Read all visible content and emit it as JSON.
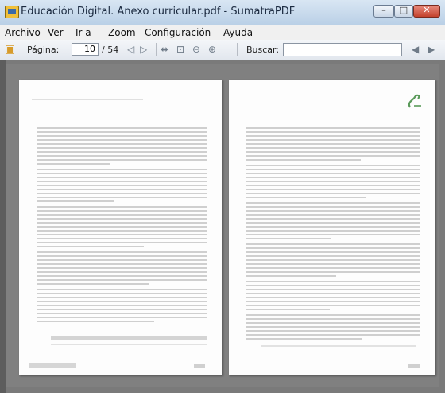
{
  "window": {
    "title": "Educación Digital. Anexo curricular.pdf - SumatraPDF",
    "controls": {
      "minimize": "–",
      "maximize": "□",
      "close": "✕"
    }
  },
  "menu": [
    "Archivo",
    "Ver",
    "Ir a",
    "Zoom",
    "Configuración",
    "Ayuda"
  ],
  "toolbar": {
    "page_label": "Página:",
    "current_page": "10",
    "total_pages": "/ 54",
    "search_label": "Buscar:",
    "search_value": ""
  }
}
